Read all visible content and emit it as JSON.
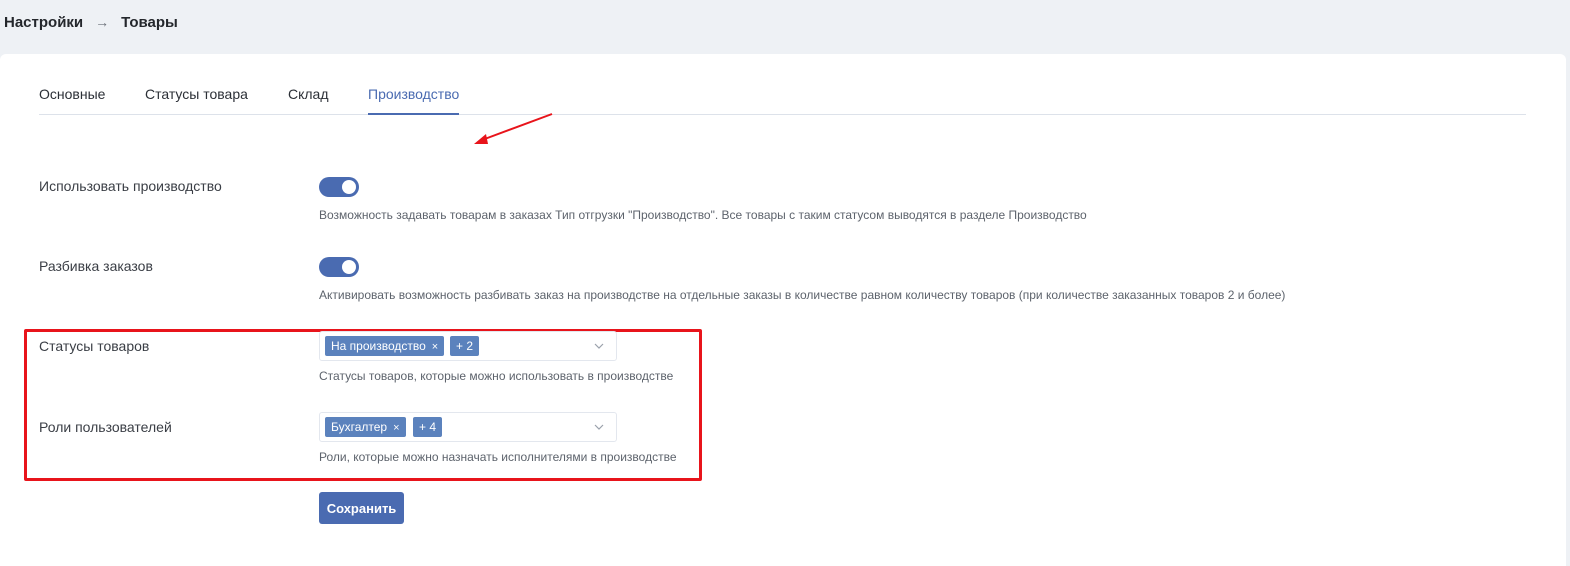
{
  "breadcrumb": {
    "root": "Настройки",
    "separator": "→",
    "current": "Товары"
  },
  "tabs": [
    {
      "label": "Основные",
      "active": false
    },
    {
      "label": "Статусы товара",
      "active": false
    },
    {
      "label": "Склад",
      "active": false
    },
    {
      "label": "Производство",
      "active": true
    }
  ],
  "settings": {
    "use_production": {
      "label": "Использовать производство",
      "enabled": true,
      "hint": "Возможность задавать товарам в заказах Тип отгрузки \"Производство\". Все товары с таким статусом выводятся в разделе Производство"
    },
    "split_orders": {
      "label": "Разбивка заказов",
      "enabled": true,
      "hint": "Активировать возможность разбивать заказ на производстве на отдельные заказы в количестве равном количеству товаров (при количестве заказанных товаров 2 и более)"
    },
    "product_statuses": {
      "label": "Статусы товаров",
      "chip": "На производство",
      "chip_remove": "×",
      "more": "+ 2",
      "hint": "Статусы товаров, которые можно использовать в производстве"
    },
    "user_roles": {
      "label": "Роли пользователей",
      "chip": "Бухгалтер",
      "chip_remove": "×",
      "more": "+ 4",
      "hint": "Роли, которые можно назначать исполнителями в производстве"
    }
  },
  "save_label": "Сохранить",
  "colors": {
    "accent": "#4a6bb1",
    "chip": "#5b82bd",
    "annotation": "#e8141b"
  }
}
